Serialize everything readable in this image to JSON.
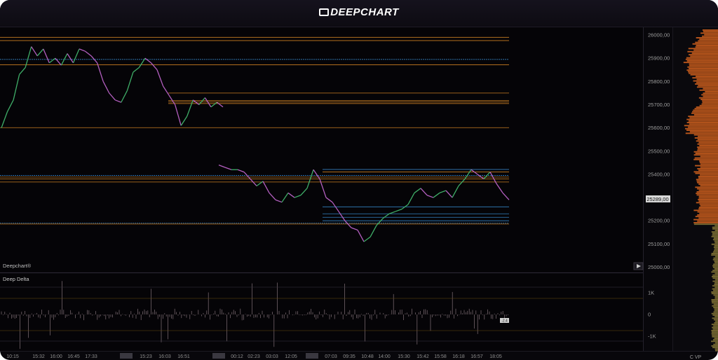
{
  "app": {
    "logo_text": "DEEPCHART"
  },
  "colors": {
    "background": "#050407",
    "candle_up": "#3fae68",
    "candle_down": "#b45fc0",
    "level_orange": "#e08c26",
    "level_blue": "#3b8fd6",
    "level_cyan": "#3fb7c8",
    "profile_orange": "#d8641e",
    "profile_olive": "#8a7a3a"
  },
  "price_axis": {
    "ticks": [
      "26000,00",
      "25900,00",
      "25800,00",
      "25700,00",
      "25600,00",
      "25500,00",
      "25400,00",
      "25300,00",
      "25200,00",
      "25100,00",
      "25000,00"
    ],
    "current_price": "25289,00"
  },
  "delta_axis": {
    "ticks": [
      "1K",
      "0",
      "-1K"
    ]
  },
  "time_axis": {
    "ticks": [
      "10:15",
      "15:32",
      "16:00",
      "16:45",
      "17:33",
      "",
      "15:23",
      "16:03",
      "16:51",
      "",
      "00:12",
      "02:23",
      "03:03",
      "12:05",
      "",
      "07:03",
      "09:35",
      "10:48",
      "14:00",
      "15:30",
      "15:42",
      "15:58",
      "16:18",
      "16:57",
      "18:05"
    ]
  },
  "panes": {
    "price_label": "Deepchart®",
    "delta_label": "Deep Delta",
    "delta_tag": "-2.4"
  },
  "profile": {
    "label": "C VP"
  },
  "chart_data": {
    "type": "line",
    "title": "",
    "ylabel": "",
    "ylim": [
      25000,
      26050
    ],
    "series": [
      {
        "kind": "price",
        "values": [
          25600,
          25670,
          25720,
          25830,
          25860,
          25950,
          25910,
          25940,
          25880,
          25900,
          25870,
          25920,
          25880,
          25940,
          25930,
          25910,
          25880,
          25800,
          25750,
          25720,
          25710,
          25760,
          25840,
          25860,
          25900,
          25880,
          25850,
          25780,
          25740,
          25700,
          25610,
          25650,
          25720,
          25700,
          25730,
          25690,
          25710,
          25690,
          25440,
          25430,
          25420,
          25420,
          25410,
          25380,
          25350,
          25370,
          25320,
          25290,
          25280,
          25320,
          25300,
          25310,
          25340,
          25420,
          25380,
          25300,
          25280,
          25240,
          25200,
          25170,
          25160,
          25110,
          25130,
          25180,
          25210,
          25230,
          25240,
          25250,
          25270,
          25320,
          25340,
          25310,
          25300,
          25320,
          25330,
          25300,
          25350,
          25380,
          25420,
          25400,
          25380,
          25410,
          25360,
          25320,
          25290
        ]
      }
    ],
    "levels": [
      {
        "price": 25990,
        "color": "orange"
      },
      {
        "price": 25976,
        "color": "orange"
      },
      {
        "price": 25895,
        "color": "blue"
      },
      {
        "price": 25872,
        "color": "orange"
      },
      {
        "price": 25750,
        "color": "orange"
      },
      {
        "price": 25718,
        "color": "orange"
      },
      {
        "price": 25712,
        "color": "orange"
      },
      {
        "price": 25705,
        "color": "orange"
      },
      {
        "price": 25601,
        "color": "orange"
      },
      {
        "price": 25395,
        "color": "blue"
      },
      {
        "price": 25388,
        "color": "orange"
      },
      {
        "price": 25380,
        "color": "orange"
      },
      {
        "price": 25367,
        "color": "orange"
      },
      {
        "price": 25190,
        "color": "blue"
      },
      {
        "price": 25186,
        "color": "orange"
      },
      {
        "price": 25421,
        "color": "blue"
      },
      {
        "price": 25410,
        "color": "orange"
      },
      {
        "price": 25260,
        "color": "blue"
      },
      {
        "price": 25230,
        "color": "blue"
      },
      {
        "price": 25215,
        "color": "blue"
      },
      {
        "price": 25200,
        "color": "blue"
      }
    ]
  }
}
